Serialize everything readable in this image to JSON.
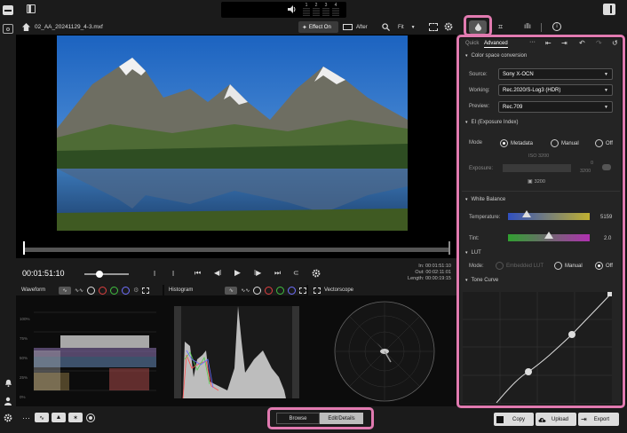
{
  "topbar": {
    "audio_channels": [
      "1",
      "2",
      "3",
      "4"
    ]
  },
  "clip": {
    "filename": "02_AA_20241129_4-3.mxf",
    "effect_label": "Effect On",
    "after_label": "After",
    "fit_label": "Fit"
  },
  "transport": {
    "timecode": "00:01:51:10",
    "in_label": "In:",
    "in_value": "00:01:51:10",
    "out_label": "Out:",
    "out_value": "00:02:11:01",
    "length_label": "Length:",
    "length_value": "00:00:19:15"
  },
  "scopes": {
    "waveform_label": "Waveform",
    "histogram_label": "Histogram",
    "vectorscope_label": "Vectorscope",
    "wf_ticks": [
      "100%",
      "75%",
      "50%",
      "25%",
      "0%"
    ]
  },
  "bottom": {
    "browse_label": "Browse",
    "edit_details_label": "Edit/Details",
    "copy_label": "Copy",
    "upload_label": "Upload",
    "export_label": "Export"
  },
  "right": {
    "tab_quick": "Quick",
    "tab_advanced": "Advanced",
    "color_space": {
      "title": "Color space conversion",
      "source_label": "Source:",
      "source_value": "Sony X-OCN",
      "working_label": "Working:",
      "working_value": "Rec.2020/S-Log3 (HDR)",
      "preview_label": "Preview:",
      "preview_value": "Rec.709"
    },
    "ei": {
      "title": "EI (Exposure Index)",
      "mode_label": "Mode",
      "opt_metadata": "Metadata",
      "opt_manual": "Manual",
      "opt_off": "Off",
      "iso_value": "ISO 3200",
      "exposure_label": "Exposure:",
      "exposure_value": "0",
      "exposure_sub": "3200",
      "icon_value": "3200"
    },
    "wb": {
      "title": "White Balance",
      "temp_label": "Temperature:",
      "temp_value": "5159",
      "tint_label": "Tint:",
      "tint_value": "2.0",
      "temp_level": 0.1,
      "tint_level": 0.5
    },
    "lut": {
      "title": "LUT",
      "mode_label": "Mode:",
      "opt_embedded": "Embedded LUT",
      "opt_manual": "Manual",
      "opt_off": "Off"
    },
    "tone": {
      "title": "Tone Curve"
    }
  }
}
